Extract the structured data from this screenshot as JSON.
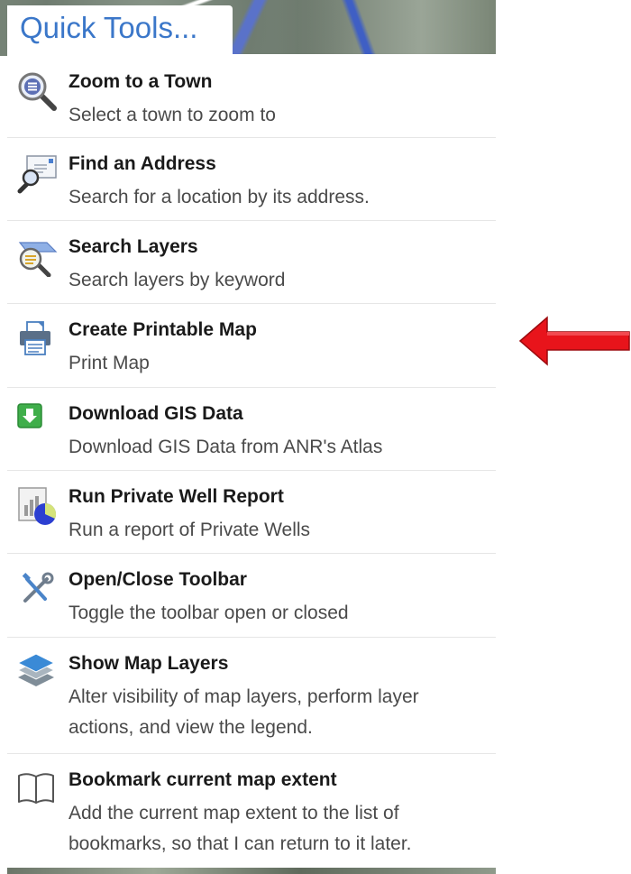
{
  "header": {
    "title": "Quick Tools..."
  },
  "tools": [
    {
      "label": "Zoom to a Town",
      "desc": "Select a town to zoom to",
      "icon": "zoom-list-icon"
    },
    {
      "label": "Find an Address",
      "desc": "Search for a location by its address.",
      "icon": "address-search-icon"
    },
    {
      "label": "Search Layers",
      "desc": "Search layers by keyword",
      "icon": "layer-search-icon"
    },
    {
      "label": "Create Printable Map",
      "desc": "Print Map",
      "icon": "printer-icon"
    },
    {
      "label": "Download GIS Data",
      "desc": "Download GIS Data from ANR's Atlas",
      "icon": "download-icon"
    },
    {
      "label": "Run Private Well Report",
      "desc": "Run a report of Private Wells",
      "icon": "report-chart-icon"
    },
    {
      "label": "Open/Close Toolbar",
      "desc": "Toggle the toolbar open or closed",
      "icon": "tools-icon"
    },
    {
      "label": "Show Map Layers",
      "desc": "Alter visibility of map layers, perform layer actions, and view the legend.",
      "icon": "layers-icon"
    },
    {
      "label": "Bookmark current map extent",
      "desc": "Add the current map extent to the list of bookmarks, so that I can return to it later.",
      "icon": "book-icon"
    }
  ],
  "colors": {
    "title": "#3b77c9",
    "annotation_arrow": "#e8141b"
  }
}
